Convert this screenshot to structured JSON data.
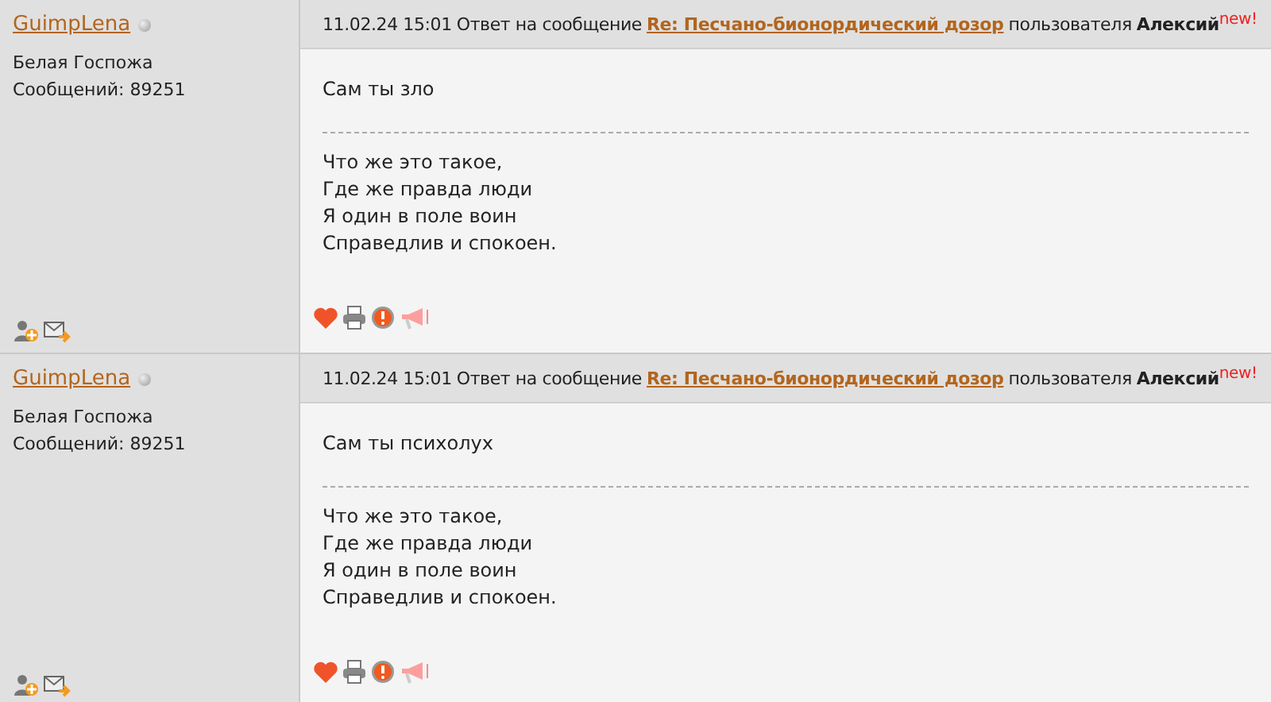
{
  "posts": [
    {
      "author": {
        "name": "GuimpLena",
        "online": false,
        "rank": "Белая Госпожа",
        "posts_count": "Сообщений: 89251"
      },
      "header": {
        "datetime": "11.02.24 15:01",
        "reply_text": "Ответ на сообщение",
        "topic_link": "Re: Песчано-бионордический дозор",
        "by_text": "пользователя",
        "reply_to": "Алексий",
        "new_badge": "new!"
      },
      "message": "Сам ты зло",
      "signature": [
        "Что же это такое,",
        "Где же правда люди",
        "Я один в поле воин",
        "Справедлив и спокоен."
      ]
    },
    {
      "author": {
        "name": "GuimpLena",
        "online": false,
        "rank": "Белая Госпожа",
        "posts_count": "Сообщений: 89251"
      },
      "header": {
        "datetime": "11.02.24 15:01",
        "reply_text": "Ответ на сообщение",
        "topic_link": "Re: Песчано-бионордический дозор",
        "by_text": "пользователя",
        "reply_to": "Алексий",
        "new_badge": "new!"
      },
      "message": "Сам ты психолух",
      "signature": [
        "Что же это такое,",
        "Где же правда люди",
        "Я один в поле воин",
        "Справедлив и спокоен."
      ]
    }
  ]
}
